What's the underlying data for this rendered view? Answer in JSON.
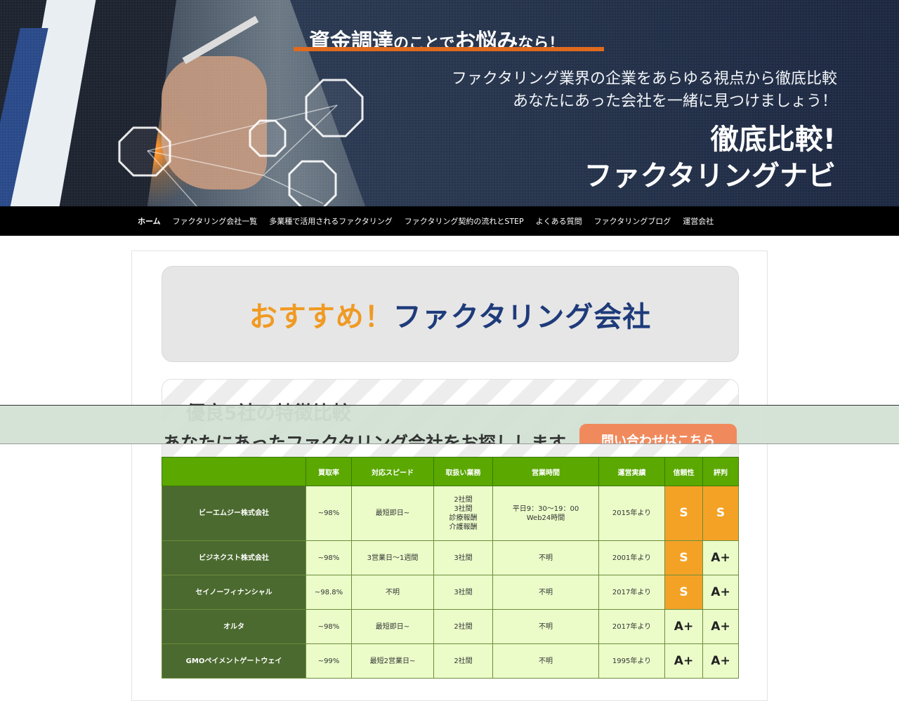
{
  "hero": {
    "headline_part1": "資金調達",
    "headline_part2": "のことで",
    "headline_part3": "お悩み",
    "headline_part4": "なら！",
    "sub_line1": "ファクタリング業界の企業をあらゆる視点から徹底比較",
    "sub_line2": "あなたにあった会社を一緒に見つけましょう！",
    "title_line1": "徹底比較!",
    "title_line2": "ファクタリングナビ",
    "accent_color": "#e06a1e"
  },
  "nav": {
    "items": [
      "ホーム",
      "ファクタリング会社一覧",
      "多業種で活用されるファクタリング",
      "ファクタリング契約の流れとSTEP",
      "よくある質問",
      "ファクタリングブログ",
      "運営会社"
    ],
    "active_index": 0
  },
  "recommend": {
    "prefix": "おすすめ！",
    "title": "ファクタリング会社",
    "prefix_color": "#f09a23",
    "title_color": "#1e3b7a"
  },
  "feature": {
    "title": "優良5社の特徴比較"
  },
  "overlay": {
    "text": "あなたにあったファクタリング会社をお探しします。",
    "contact_label": "問い合わせはこちら",
    "contact_color": "#f08a5d"
  },
  "table": {
    "headers": [
      "",
      "買取率",
      "対応スピード",
      "取扱い業務",
      "営業時間",
      "運営実績",
      "信頼性",
      "評判"
    ],
    "rows": [
      {
        "name": "ビーエムジー株式会社",
        "rate": "~98%",
        "speed": "最短即日~",
        "services": [
          "2社間",
          "3社間",
          "診療報酬",
          "介護報酬"
        ],
        "hours": [
          "平日9：30〜19：00",
          "Web24時間"
        ],
        "since": "2015年より",
        "trust": "S",
        "reputation": "S"
      },
      {
        "name": "ビジネクスト株式会社",
        "rate": "~98%",
        "speed": "3営業日〜1週間",
        "services": [
          "3社間"
        ],
        "hours": [
          "不明"
        ],
        "since": "2001年より",
        "trust": "S",
        "reputation": "A+"
      },
      {
        "name": "セイノーフィナンシャル",
        "rate": "~98.8%",
        "speed": "不明",
        "services": [
          "3社間"
        ],
        "hours": [
          "不明"
        ],
        "since": "2017年より",
        "trust": "S",
        "reputation": "A+"
      },
      {
        "name": "オルタ",
        "rate": "~98%",
        "speed": "最短即日~",
        "services": [
          "2社間"
        ],
        "hours": [
          "不明"
        ],
        "since": "2017年より",
        "trust": "A+",
        "reputation": "A+"
      },
      {
        "name": "GMOペイメントゲートウェイ",
        "rate": "~99%",
        "speed": "最短2営業日~",
        "services": [
          "2社間"
        ],
        "hours": [
          "不明"
        ],
        "since": "1995年より",
        "trust": "A+",
        "reputation": "A+"
      }
    ],
    "colors": {
      "header": "#5aa800",
      "name_cell": "#4b6a2f",
      "cell": "#ebfcc9",
      "grade_s": "#f4a226"
    }
  }
}
